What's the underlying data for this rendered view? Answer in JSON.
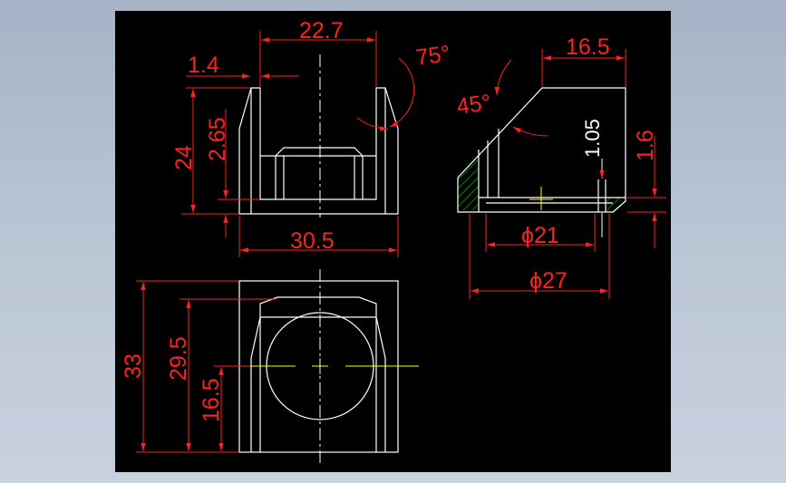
{
  "colors": {
    "background_outer": "#b4c0d1",
    "drawing_area": "#000000",
    "outline": "#ffffff",
    "dimension": "#ff2020",
    "centerline": "#ffff00",
    "hatch": "#00c000"
  },
  "front_view": {
    "dim_top_width": "22.7",
    "dim_left_step": "1.4",
    "dim_angle_right": "75°",
    "dim_height_outer": "24",
    "dim_height_inner": "2.65",
    "dim_bottom_width": "30.5"
  },
  "side_view": {
    "dim_top_width": "16.5",
    "dim_angle_left": "45°",
    "dim_groove": "1.05",
    "dim_height_right": "1.6",
    "dim_dia_small": "ϕ21",
    "dim_dia_large": "ϕ27"
  },
  "top_view": {
    "dim_height_total": "33",
    "dim_height_mid": "29.5",
    "dim_height_center": "16.5"
  }
}
